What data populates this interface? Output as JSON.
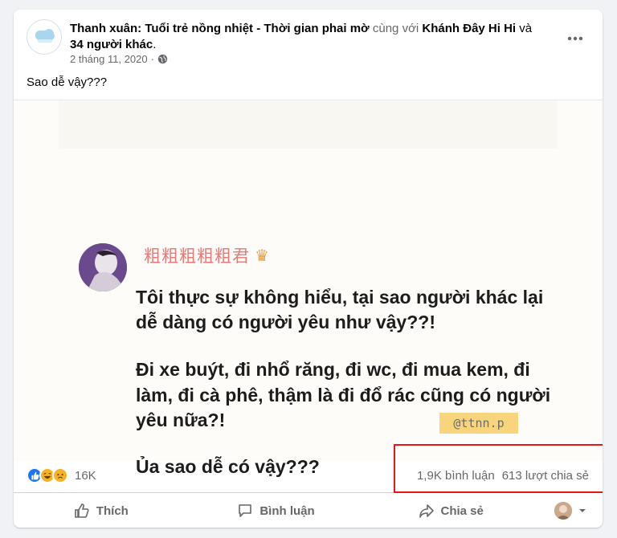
{
  "post": {
    "author": "Thanh xuân: Tuổi trẻ nồng nhiệt - Thời gian phai mờ",
    "with_text": "cùng với",
    "tagged_user": "Khánh Đây Hi Hi",
    "and_text": "và",
    "others": "34 người khác",
    "date": "2 tháng 11, 2020",
    "caption": "Sao dễ vậy???"
  },
  "image": {
    "username": "粗粗粗粗粗君",
    "line1": "Tôi thực sự không hiểu, tại sao người khác lại",
    "line2": "dễ dàng có người yêu như vậy??!",
    "line3": "Đi xe buýt, đi nhổ răng, đi wc, đi mua kem, đi",
    "line4": "làm, đi cà phê, thậm là đi đổ rác cũng có người",
    "line5": "yêu nữa?!",
    "line6": "Ủa sao dễ có vậy???",
    "watermark": "@ttnn.p"
  },
  "stats": {
    "reaction_count": "16K",
    "comments": "1,9K bình luận",
    "shares": "613 lượt chia sẻ"
  },
  "actions": {
    "like": "Thích",
    "comment": "Bình luận",
    "share": "Chia sẻ"
  },
  "colors": {
    "highlight": "#e8161c",
    "like_blue": "#1877f2",
    "haha_yellow": "#f7b125"
  }
}
